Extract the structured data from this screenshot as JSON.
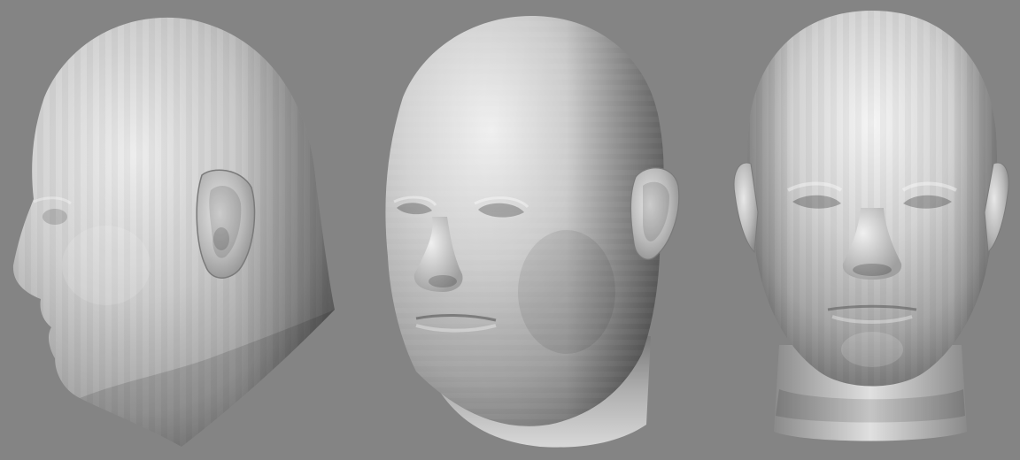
{
  "scene": {
    "background_color": "#848484",
    "surface_color": "#c8c8c8",
    "highlight_color": "#f2f2f2",
    "shadow_color": "#6e6e6e",
    "shading": "faceted-flat",
    "views": [
      {
        "id": "left-profile",
        "semantic": "head-mesh-left-profile"
      },
      {
        "id": "three-quarter",
        "semantic": "head-mesh-three-quarter"
      },
      {
        "id": "front",
        "semantic": "head-mesh-front"
      }
    ]
  }
}
